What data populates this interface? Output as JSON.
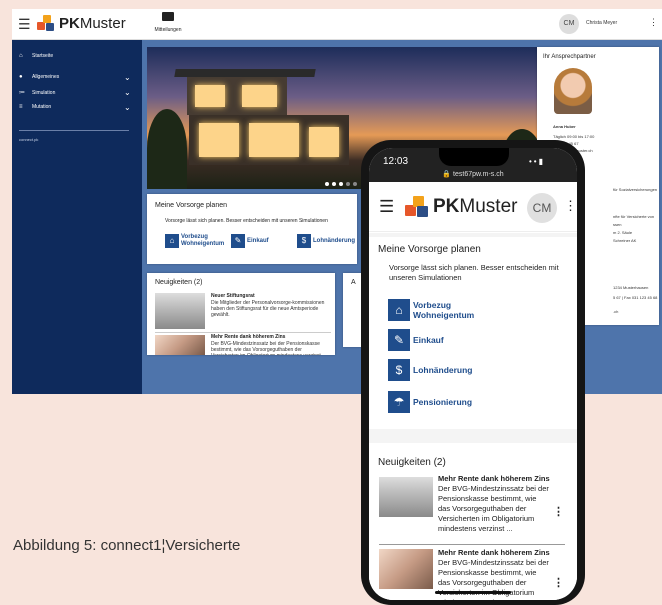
{
  "desktop": {
    "brand": {
      "pk": "PK",
      "rest": "Muster"
    },
    "messages_label": "Mitteilungen",
    "user": {
      "initials": "CM",
      "name": "Christa Meyer"
    },
    "sidebar": {
      "items": [
        {
          "label": "Startseite",
          "icon": "home-icon"
        },
        {
          "label": "Allgemeines",
          "icon": "person-icon"
        },
        {
          "label": "Simulation",
          "icon": "calculator-icon"
        },
        {
          "label": "Mutation",
          "icon": "edit-icon"
        }
      ],
      "footer": "connect.pk"
    },
    "vorsorge": {
      "title": "Meine Vorsorge planen",
      "text": "Vorsorge lässt sich planen. Besser entscheiden mit unseren Simulationen",
      "actions": [
        {
          "label_line1": "Vorbezug",
          "label_line2": "Wohneigentum"
        },
        {
          "label_line1": "Einkauf",
          "label_line2": ""
        },
        {
          "label_line1": "Lohnänderung",
          "label_line2": ""
        }
      ]
    },
    "news": {
      "title": "Neuigkeiten (2)",
      "items": [
        {
          "head": "Neuer Stiftungsrat",
          "body": "Die Mitglieder der Personalvorsorge-kommissionen haben den Stiftungsrat für die neue Amtsperiode gewählt."
        },
        {
          "head": "Mehr Rente dank höherem Zins",
          "body": "Der BVG-Mindestzinssatz bei der Pensionskasse bestimmt, wie das Vorsorgeguthaben der Versicherten im Obligatorium mindestens verzinst ..."
        }
      ],
      "peek_letter": "A"
    },
    "contact": {
      "title": "Ihr Ansprechpartner",
      "name": "Anna Huber",
      "hours": "Täglich 09:00 bis 17:00",
      "phone_partial": "031 123 45 67",
      "email_partial": "@pkmuster.ch",
      "lines": [
        "für Sozialversicherungen",
        "nfte für Versicherte von",
        "ssen",
        "m 2. Säule",
        "Schreiner AK"
      ],
      "address": "1234 Musterhausen",
      "tel_fax": "5 67 | Fax 031 123 45 68",
      "web_partial": ".ch"
    }
  },
  "phone": {
    "time": "12:03",
    "url": "test67pw.m-s.ch",
    "brand": {
      "pk": "PK",
      "rest": "Muster"
    },
    "initials": "CM",
    "vorsorge": {
      "title": "Meine Vorsorge planen",
      "text": "Vorsorge lässt sich planen. Besser entscheiden mit unseren Simulationen",
      "actions": [
        {
          "line1": "Vorbezug",
          "line2": "Wohneigentum"
        },
        {
          "line1": "Einkauf",
          "line2": ""
        },
        {
          "line1": "Lohnänderung",
          "line2": ""
        },
        {
          "line1": "Pensionierung",
          "line2": ""
        }
      ]
    },
    "news": {
      "title": "Neuigkeiten (2)",
      "items": [
        {
          "head": "Mehr Rente dank höherem Zins",
          "body": "Der BVG-Mindestzinssatz bei der Pensionskasse bestimmt, wie das Vorsorgeguthaben der Versicherten im Obligatorium mindestens verzinst ..."
        },
        {
          "head": "Mehr Rente dank höherem Zins",
          "body": "Der BVG-Mindestzinssatz bei der Pensionskasse bestimmt, wie das Vorsorgeguthaben der Versicherten im Obligatorium mindestens verzinst ..."
        }
      ]
    }
  },
  "caption": "Abbildung 5: connect1¦Versicherte",
  "colors": {
    "sidebar": "#0e2a5c",
    "accent": "#1f4d8c",
    "background": "#f8e4dc"
  }
}
